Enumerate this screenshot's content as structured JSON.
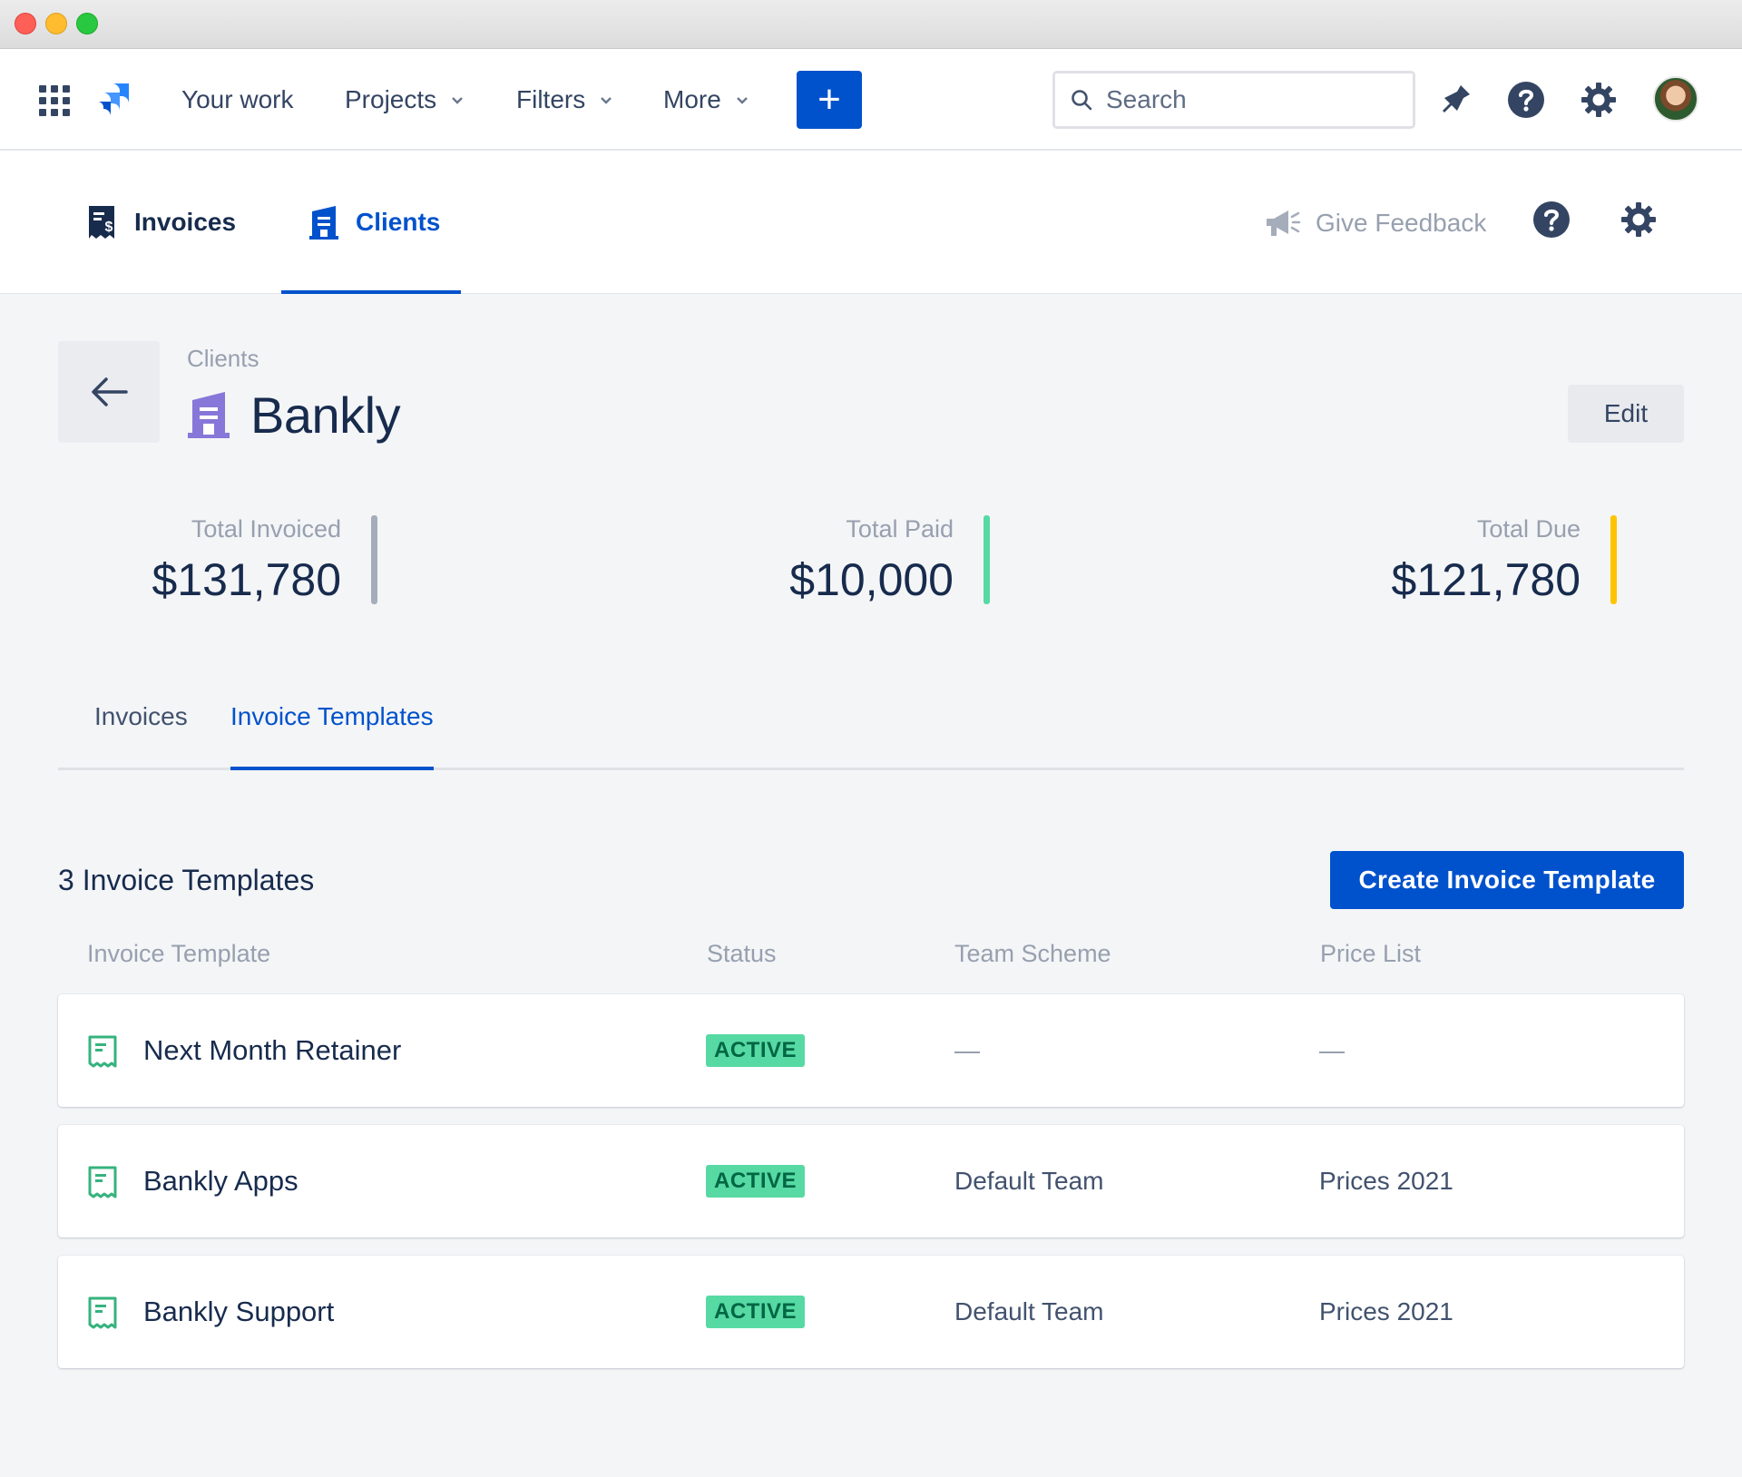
{
  "nav": {
    "items": [
      {
        "label": "Your work",
        "has_dropdown": false
      },
      {
        "label": "Projects",
        "has_dropdown": true
      },
      {
        "label": "Filters",
        "has_dropdown": true
      },
      {
        "label": "More",
        "has_dropdown": true
      }
    ],
    "create_label": "+",
    "search_placeholder": "Search"
  },
  "subnav": {
    "tabs": [
      {
        "label": "Invoices",
        "active": false
      },
      {
        "label": "Clients",
        "active": true
      }
    ],
    "feedback_label": "Give Feedback"
  },
  "header": {
    "breadcrumb": "Clients",
    "title": "Bankly",
    "edit_label": "Edit"
  },
  "stats": [
    {
      "label": "Total Invoiced",
      "value": "$131,780",
      "color": "#a5adba"
    },
    {
      "label": "Total Paid",
      "value": "$10,000",
      "color": "#57d9a3"
    },
    {
      "label": "Total Due",
      "value": "$121,780",
      "color": "#ffc400"
    }
  ],
  "tabs": [
    {
      "label": "Invoices",
      "active": false
    },
    {
      "label": "Invoice Templates",
      "active": true
    }
  ],
  "section": {
    "title": "3 Invoice Templates",
    "create_label": "Create Invoice Template"
  },
  "table": {
    "columns": [
      "Invoice Template",
      "Status",
      "Team Scheme",
      "Price List"
    ],
    "rows": [
      {
        "name": "Next Month Retainer",
        "status": "ACTIVE",
        "team": "",
        "price": ""
      },
      {
        "name": "Bankly Apps",
        "status": "ACTIVE",
        "team": "Default Team",
        "price": "Prices 2021"
      },
      {
        "name": "Bankly Support",
        "status": "ACTIVE",
        "team": "Default Team",
        "price": "Prices 2021"
      }
    ]
  },
  "colors": {
    "brand": "#0052cc",
    "status_bg": "#57d9a3",
    "status_text": "#006644",
    "client_icon": "#8777d9"
  },
  "icons": [
    "app-switcher-icon",
    "jira-logo-icon",
    "search-icon",
    "notification-icon",
    "help-icon",
    "settings-icon",
    "invoice-dollar-icon",
    "client-building-icon",
    "megaphone-icon",
    "back-arrow-icon",
    "receipt-icon"
  ]
}
